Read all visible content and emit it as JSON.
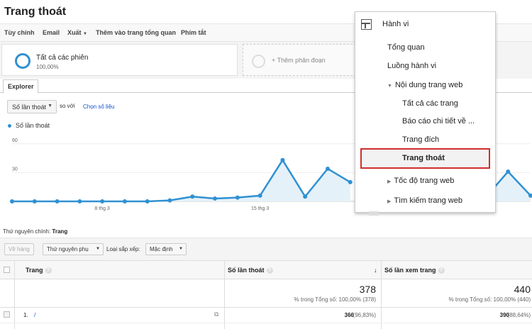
{
  "page": {
    "title": "Trang thoát"
  },
  "toolbar": {
    "customize": "Tùy chỉnh",
    "email": "Email",
    "export": "Xuất",
    "add_dashboard": "Thêm vào trang tổng quan",
    "shortcut": "Phím tắt"
  },
  "segments": {
    "active_name": "Tất cả các phiên",
    "active_pct": "100,00%",
    "add_label": "+ Thêm phân đoạn"
  },
  "tabs": {
    "explorer": "Explorer"
  },
  "chart_controls": {
    "metric": "Số lần thoát",
    "compare_label": "so với",
    "select_metric": "Chọn số liệu"
  },
  "chart_data": {
    "type": "area",
    "legend": "Số lần thoát",
    "x": [
      "4 thg 3",
      "5 thg 3",
      "6 thg 3",
      "7 thg 3",
      "8 thg 3",
      "9 thg 3",
      "10 thg 3",
      "11 thg 3",
      "12 thg 3",
      "13 thg 3",
      "14 thg 3",
      "15 thg 3",
      "16 thg 3",
      "17 thg 3",
      "18 thg 3",
      "19 thg 3",
      "20 thg 3",
      "21 thg 3",
      "22 thg 3",
      "23 thg 3",
      "24 thg 3",
      "25 thg 3",
      "26 thg 3",
      "27 thg 3"
    ],
    "values": [
      0,
      0,
      0,
      0,
      0,
      0,
      0,
      1,
      5,
      3,
      4,
      6,
      43,
      5,
      34,
      20,
      null,
      null,
      null,
      null,
      null,
      4,
      31,
      6
    ],
    "yticks": [
      "60",
      "30"
    ],
    "xticks": [
      "8 thg 3",
      "15 thg 3"
    ],
    "ylim": [
      0,
      65
    ],
    "color": "#3091d2",
    "fill": "#e5f1f9"
  },
  "table_meta": {
    "primary_dimension_label": "Thứ nguyên chính:",
    "primary_dimension_value": "Trang",
    "plot_rows": "Vẽ hàng",
    "secondary_dimension": "Thứ nguyên phụ",
    "sort_type_label": "Loại sắp xếp:",
    "sort_type_value": "Mặc định"
  },
  "columns": {
    "page": "Trang",
    "exits": "Số lần thoát",
    "pageviews": "Số lần xem trang"
  },
  "totals": {
    "exits": "378",
    "exits_sub": "% trong Tổng số: 100,00% (378)",
    "pageviews": "440",
    "pageviews_sub": "% trong Tổng số: 100,00% (440)"
  },
  "rows": [
    {
      "index": "1.",
      "page": "/",
      "exits": "366",
      "exits_pct": "(96,83%)",
      "pageviews": "390",
      "pageviews_pct": "(88,64%)"
    }
  ],
  "menu": {
    "header": "Hành vi",
    "items": [
      "Tổng quan",
      "Luồng hành vi"
    ],
    "content_group": "Nội dung trang web",
    "content_items": [
      "Tất cả các trang",
      "Báo cáo chi tiết về ...",
      "Trang đích",
      "Trang thoát"
    ],
    "speed": "Tốc độ trang web",
    "search": "Tìm kiếm trang web"
  }
}
